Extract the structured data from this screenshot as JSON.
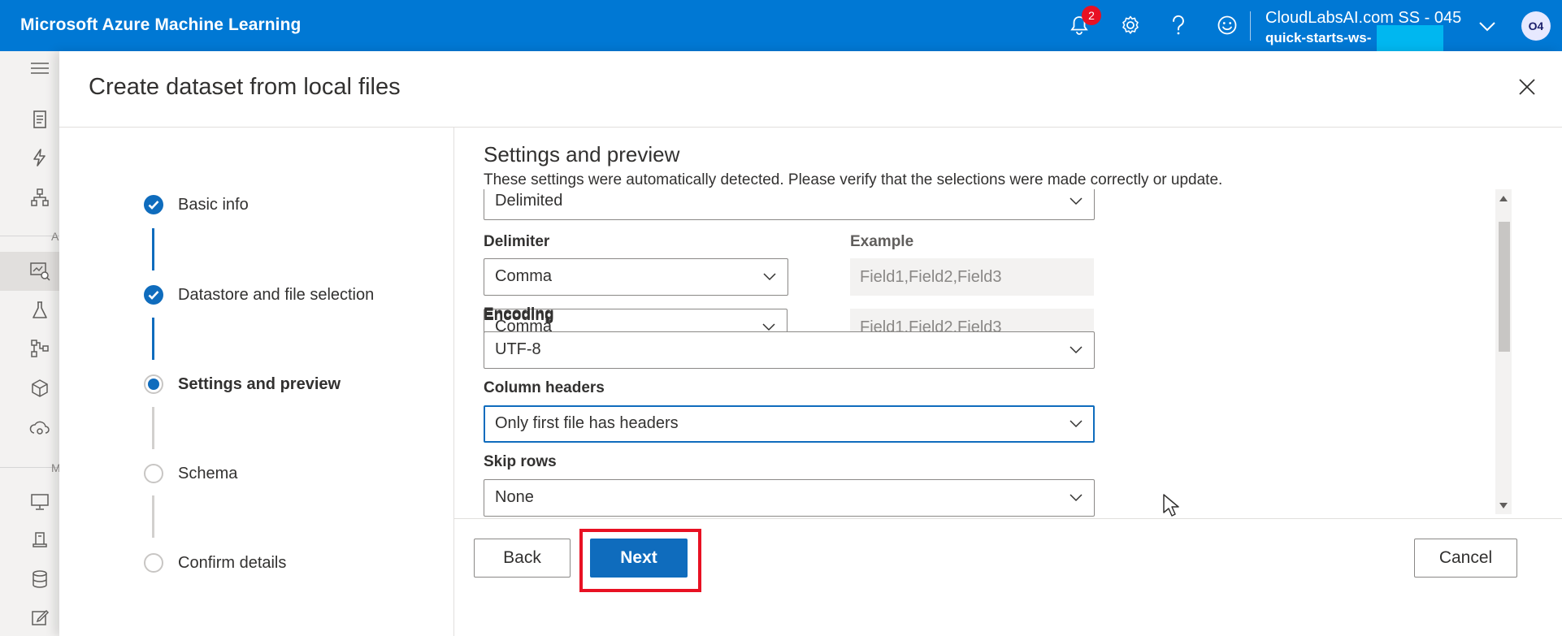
{
  "header": {
    "brand": "Microsoft Azure Machine Learning",
    "notification_count": "2",
    "account_name": "CloudLabsAI.com SS - 045",
    "workspace": "quick-starts-ws-",
    "avatar_initials": "O4"
  },
  "sidebar": {
    "section_letters": [
      "A",
      "M"
    ],
    "icons": [
      "hamburger-icon",
      "notebook-icon",
      "automl-icon",
      "designer-icon",
      "datasets-icon",
      "experiments-icon",
      "pipelines-icon",
      "models-icon",
      "endpoints-icon",
      "compute-icon",
      "datastores-icon",
      "data-labeling-icon",
      "edit-icon"
    ]
  },
  "panel": {
    "title": "Create dataset from local files",
    "steps": [
      {
        "label": "Basic info",
        "state": "done"
      },
      {
        "label": "Datastore and file selection",
        "state": "done"
      },
      {
        "label": "Settings and preview",
        "state": "current"
      },
      {
        "label": "Schema",
        "state": "todo"
      },
      {
        "label": "Confirm details",
        "state": "todo"
      }
    ],
    "section_title": "Settings and preview",
    "section_description": "These settings were automatically detected. Please verify that the selections were made correctly or update.",
    "fields": {
      "file_format_value": "Delimited",
      "delimiter_label": "Delimiter",
      "delimiter_value": "Comma",
      "example_label": "Example",
      "example_value": "Field1,Field2,Field3",
      "encoding_label": "Encoding",
      "encoding_value": "UTF-8",
      "column_headers_label": "Column headers",
      "column_headers_value": "Only first file has headers",
      "skip_rows_label": "Skip rows",
      "skip_rows_value": "None"
    },
    "buttons": {
      "back": "Back",
      "next": "Next",
      "cancel": "Cancel"
    }
  },
  "colors": {
    "brand_blue": "#0078d4",
    "primary": "#0f6cbd",
    "highlight_red": "#e81123"
  }
}
